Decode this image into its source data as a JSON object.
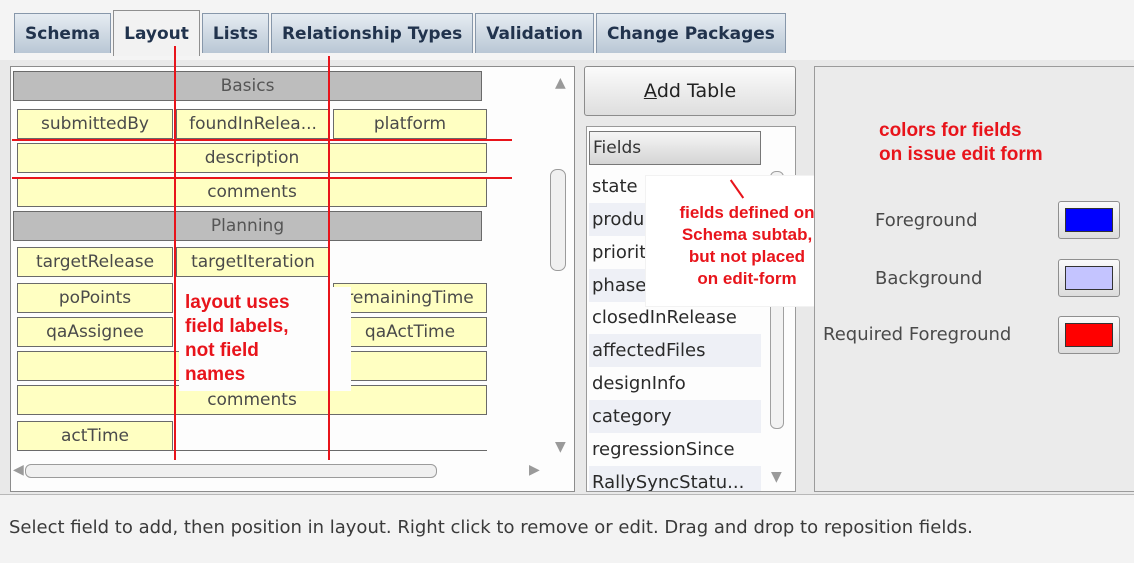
{
  "tabs": [
    "Schema",
    "Layout",
    "Lists",
    "Relationship Types",
    "Validation",
    "Change Packages"
  ],
  "active_tab": "Layout",
  "layout": {
    "cells": [
      {
        "label": "Basics",
        "style": "gray"
      },
      {
        "label": "submittedBy",
        "style": "yellow"
      },
      {
        "label": "foundInRelea...",
        "style": "yellow"
      },
      {
        "label": "platform",
        "style": "yellow"
      },
      {
        "label": "description",
        "style": "yellow"
      },
      {
        "label": "comments",
        "style": "yellow"
      },
      {
        "label": "Planning",
        "style": "gray"
      },
      {
        "label": "targetRelease",
        "style": "yellow"
      },
      {
        "label": "targetIteration",
        "style": "yellow"
      },
      {
        "label": "poPoints",
        "style": "yellow"
      },
      {
        "label": "remainingTime",
        "style": "yellow"
      },
      {
        "label": "qaAssignee",
        "style": "yellow"
      },
      {
        "label": "qaActTime",
        "style": "yellow"
      },
      {
        "label": "",
        "style": "yellow"
      },
      {
        "label": "comments",
        "style": "yellow"
      },
      {
        "label": "actTime",
        "style": "yellow"
      }
    ]
  },
  "add_table_button": {
    "accesskey": "A",
    "rest": "dd Table"
  },
  "fields": {
    "header": "Fields",
    "items": [
      "state",
      "product",
      "priority",
      "phase",
      "closedInRelease",
      "affectedFiles",
      "designInfo",
      "category",
      "regressionSince",
      "RallySyncStatu..."
    ]
  },
  "annotations": {
    "layout_note": "layout uses\nfield labels,\nnot field\nnames",
    "fields_note": "fields defined on\nSchema subtab,\nbut not placed\non edit-form",
    "colors_note": "colors for fields\non issue edit form"
  },
  "colors": {
    "items": [
      {
        "label": "Foreground",
        "color": "#0000ff"
      },
      {
        "label": "Background",
        "color": "#c4c4ff"
      },
      {
        "label": "Required Foreground",
        "color": "#ff0000"
      }
    ]
  },
  "status": "Select field to add, then position in layout. Right click to remove or edit. Drag and drop to reposition fields."
}
